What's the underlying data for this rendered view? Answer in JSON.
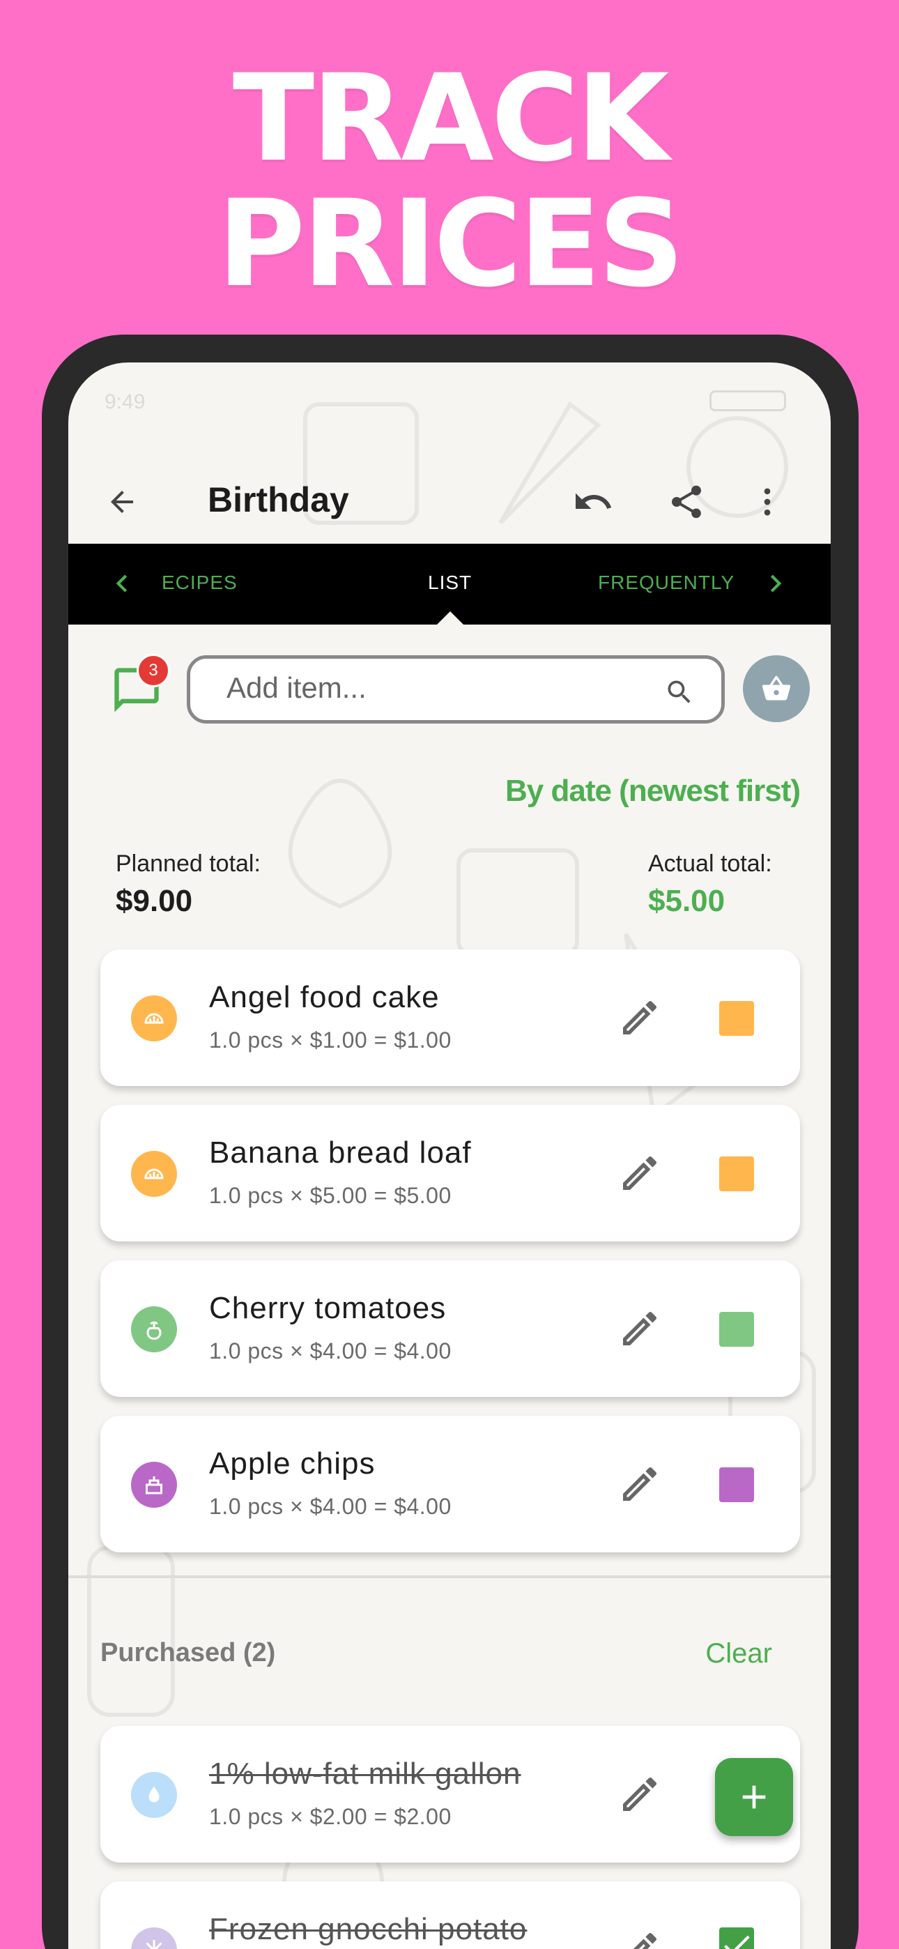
{
  "headline": [
    "TRACK",
    "PRICES"
  ],
  "status_bar": {
    "time": "9:49"
  },
  "app_bar": {
    "title": "Birthday"
  },
  "tabs": {
    "left": "ECIPES",
    "active": "LIST",
    "right": "FREQUENTLY"
  },
  "messages_badge": "3",
  "search": {
    "placeholder": "Add item..."
  },
  "sort_label": "By date (newest first)",
  "totals": {
    "planned_label": "Planned total:",
    "planned_value": "$9.00",
    "actual_label": "Actual total:",
    "actual_value": "$5.00"
  },
  "items": [
    {
      "name": "Angel food cake",
      "calc": "1.0 pcs × $1.00 = $1.00",
      "category_color": "#ffb74d",
      "category_icon": "bakery-icon"
    },
    {
      "name": "Banana bread loaf",
      "calc": "1.0 pcs × $5.00 = $5.00",
      "category_color": "#ffb74d",
      "category_icon": "bakery-icon"
    },
    {
      "name": "Cherry tomatoes",
      "calc": "1.0 pcs × $4.00 = $4.00",
      "category_color": "#81c784",
      "category_icon": "produce-icon"
    },
    {
      "name": "Apple chips",
      "calc": "1.0 pcs × $4.00 = $4.00",
      "category_color": "#ba68c8",
      "category_icon": "snacks-icon"
    }
  ],
  "purchased": {
    "title": "Purchased (2)",
    "clear": "Clear",
    "items": [
      {
        "name": "1% low-fat milk gallon",
        "calc": "1.0 pcs × $2.00 = $2.00",
        "category_color": "#bbdefb",
        "category_icon": "dairy-icon"
      },
      {
        "name": "Frozen gnocchi potato",
        "calc": "",
        "category_color": "#d1c4e9",
        "category_icon": "frozen-icon"
      }
    ]
  },
  "colors": {
    "accent": "#4caf50",
    "background": "#ff6fc8"
  }
}
